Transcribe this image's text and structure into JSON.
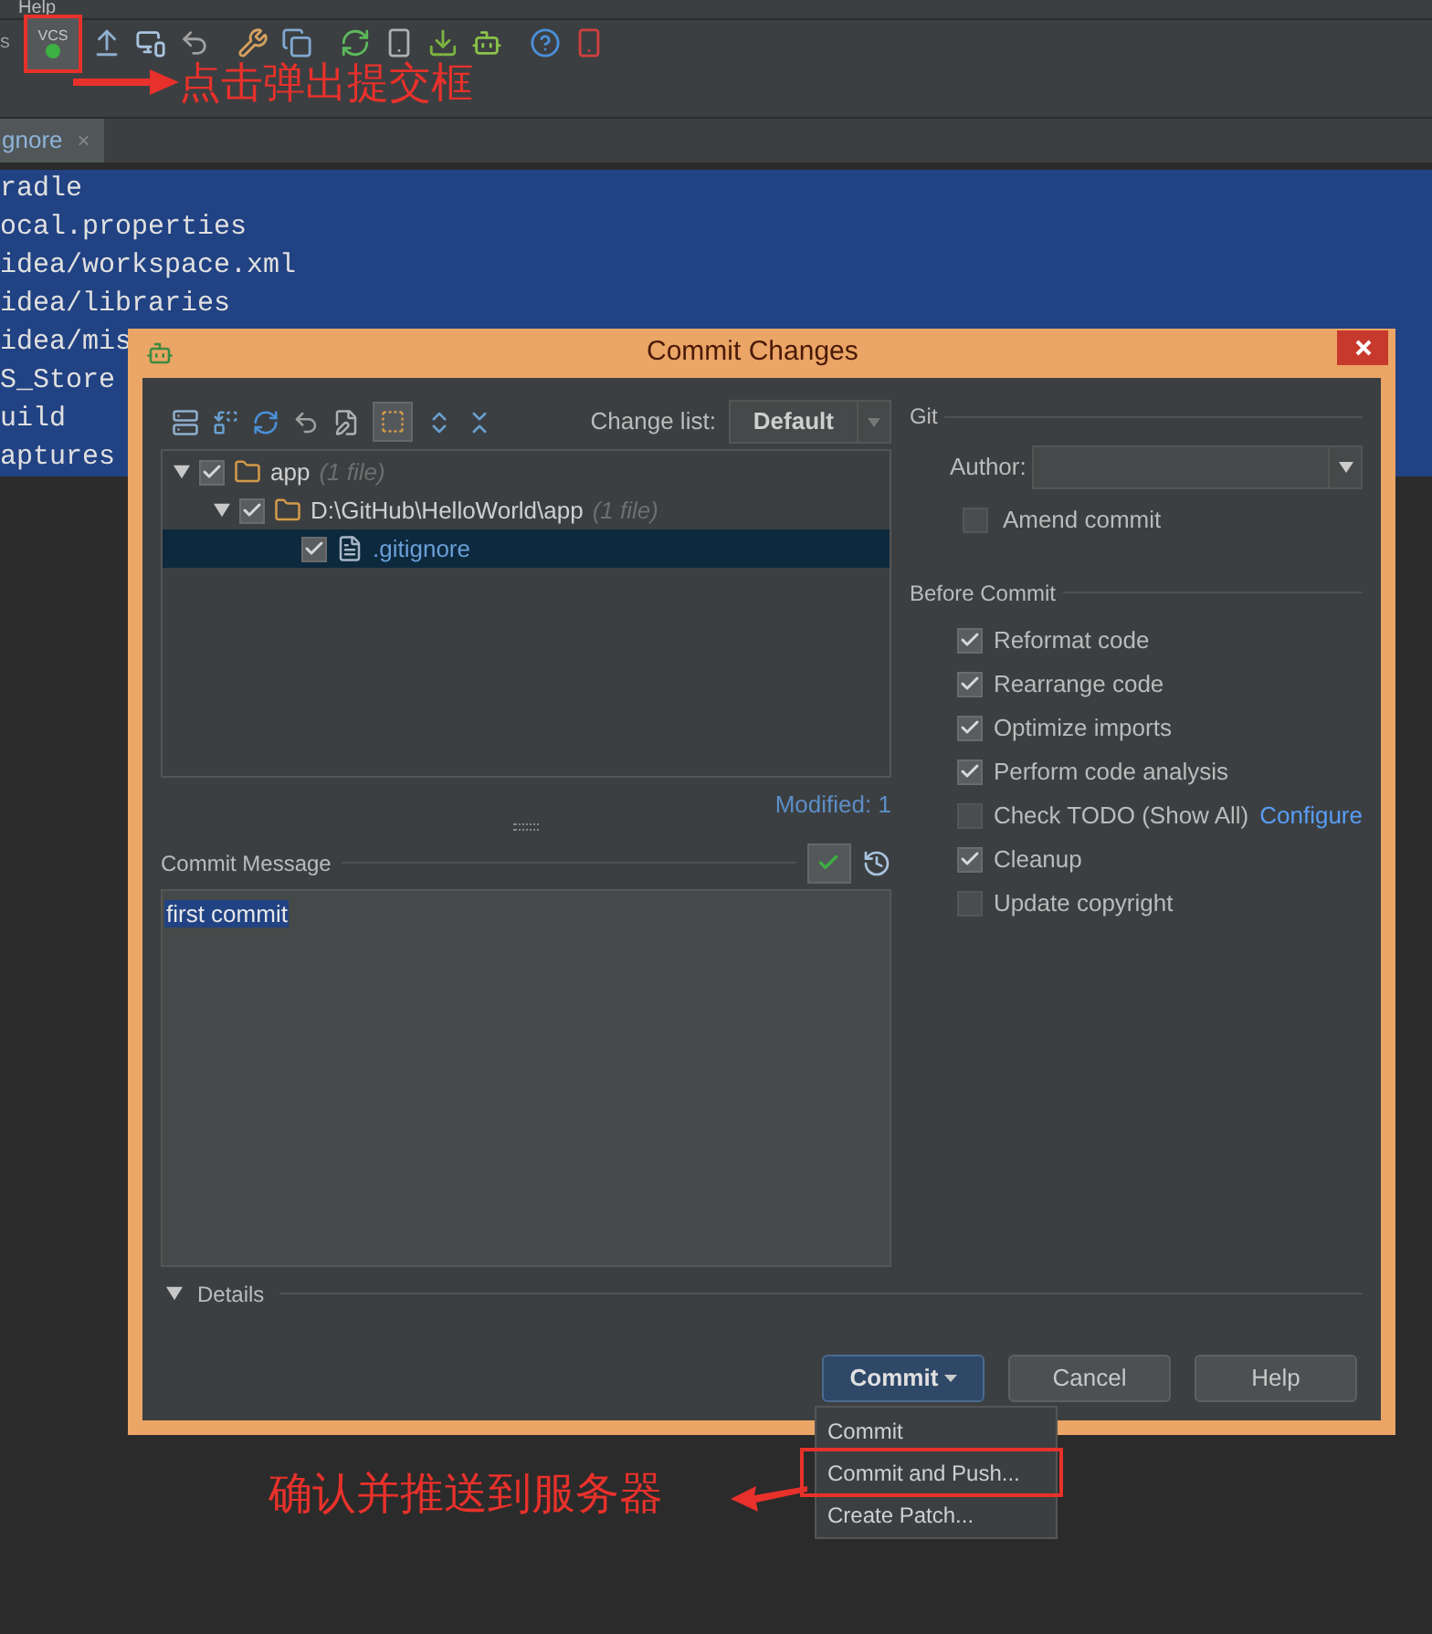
{
  "menu_bar": {
    "items": [
      "Help"
    ]
  },
  "toolbar": {
    "cut_label": "S",
    "vcs_button": {
      "label": "VCS",
      "annotated": true
    }
  },
  "annotations": [
    {
      "text": "点击弹出提交框"
    },
    {
      "text": "确认并推送到服务器"
    }
  ],
  "editor": {
    "tab": {
      "label": "gnore",
      "close": "×"
    },
    "lines": [
      {
        "text": "radle",
        "selected": true
      },
      {
        "text": "ocal.properties",
        "selected": true
      },
      {
        "text": "idea/workspace.xml",
        "selected": true
      },
      {
        "text": "idea/libraries",
        "selected": true
      },
      {
        "text": "idea/mis",
        "selected": true
      },
      {
        "text": "S_Store",
        "selected": true
      },
      {
        "text": "uild",
        "selected": true
      },
      {
        "text": "aptures",
        "selected": true
      }
    ]
  },
  "dialog": {
    "title": "Commit Changes",
    "change_list": {
      "label": "Change list:",
      "value": "Default"
    },
    "tree": [
      {
        "name": "app",
        "note": "(1 file)",
        "checked": true,
        "expanded": true,
        "selected": false,
        "children": [
          {
            "name": "D:\\GitHub\\HelloWorld\\app",
            "note": "(1 file)",
            "checked": true,
            "expanded": true,
            "selected": false,
            "children": [
              {
                "name": ".gitignore",
                "checked": true,
                "selected": true
              }
            ]
          }
        ]
      }
    ],
    "modified": "Modified: 1",
    "commit_message": {
      "label": "Commit Message",
      "value": "first commit"
    },
    "details": {
      "label": "Details"
    },
    "git": {
      "heading": "Git",
      "author": {
        "label": "Author:"
      },
      "amend": {
        "label": "Amend commit",
        "checked": false
      }
    },
    "before_commit": {
      "heading": "Before Commit",
      "options": [
        {
          "label": "Reformat code",
          "checked": true
        },
        {
          "label": "Rearrange code",
          "checked": true
        },
        {
          "label": "Optimize imports",
          "checked": true
        },
        {
          "label": "Perform code analysis",
          "checked": true
        },
        {
          "label": "Check TODO (Show All)",
          "checked": false,
          "link": "Configure"
        },
        {
          "label": "Cleanup",
          "checked": true
        },
        {
          "label": "Update copyright",
          "checked": false
        }
      ]
    },
    "buttons": [
      {
        "label": "Commit",
        "kind": "split",
        "default": true
      },
      {
        "label": "Cancel",
        "kind": "plain",
        "default": false
      },
      {
        "label": "Help",
        "kind": "plain",
        "default": false
      }
    ]
  },
  "popup_menu": [
    {
      "label": "Commit",
      "annotated": false
    },
    {
      "label": "Commit and Push...",
      "annotated": true
    },
    {
      "label": "Create Patch...",
      "annotated": false
    }
  ]
}
